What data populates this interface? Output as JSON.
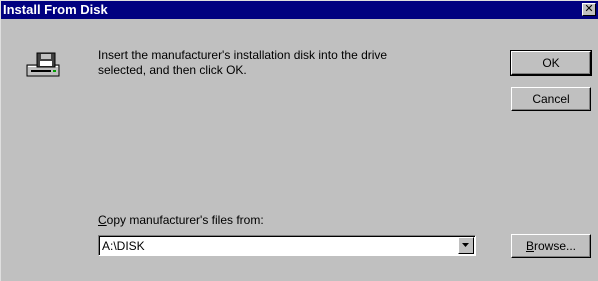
{
  "window": {
    "title": "Install From Disk",
    "close_glyph": "✕"
  },
  "dialog": {
    "icon": "floppy-drive-icon",
    "message_line1": "Insert the manufacturer's installation disk into the drive",
    "message_line2": "selected, and then click OK.",
    "ok_label": "OK",
    "cancel_label": "Cancel",
    "copy_label_accel": "C",
    "copy_label_rest": "opy manufacturer's files from:",
    "path_value": "A:\\DISK",
    "browse_accel": "B",
    "browse_rest": "rowse..."
  }
}
